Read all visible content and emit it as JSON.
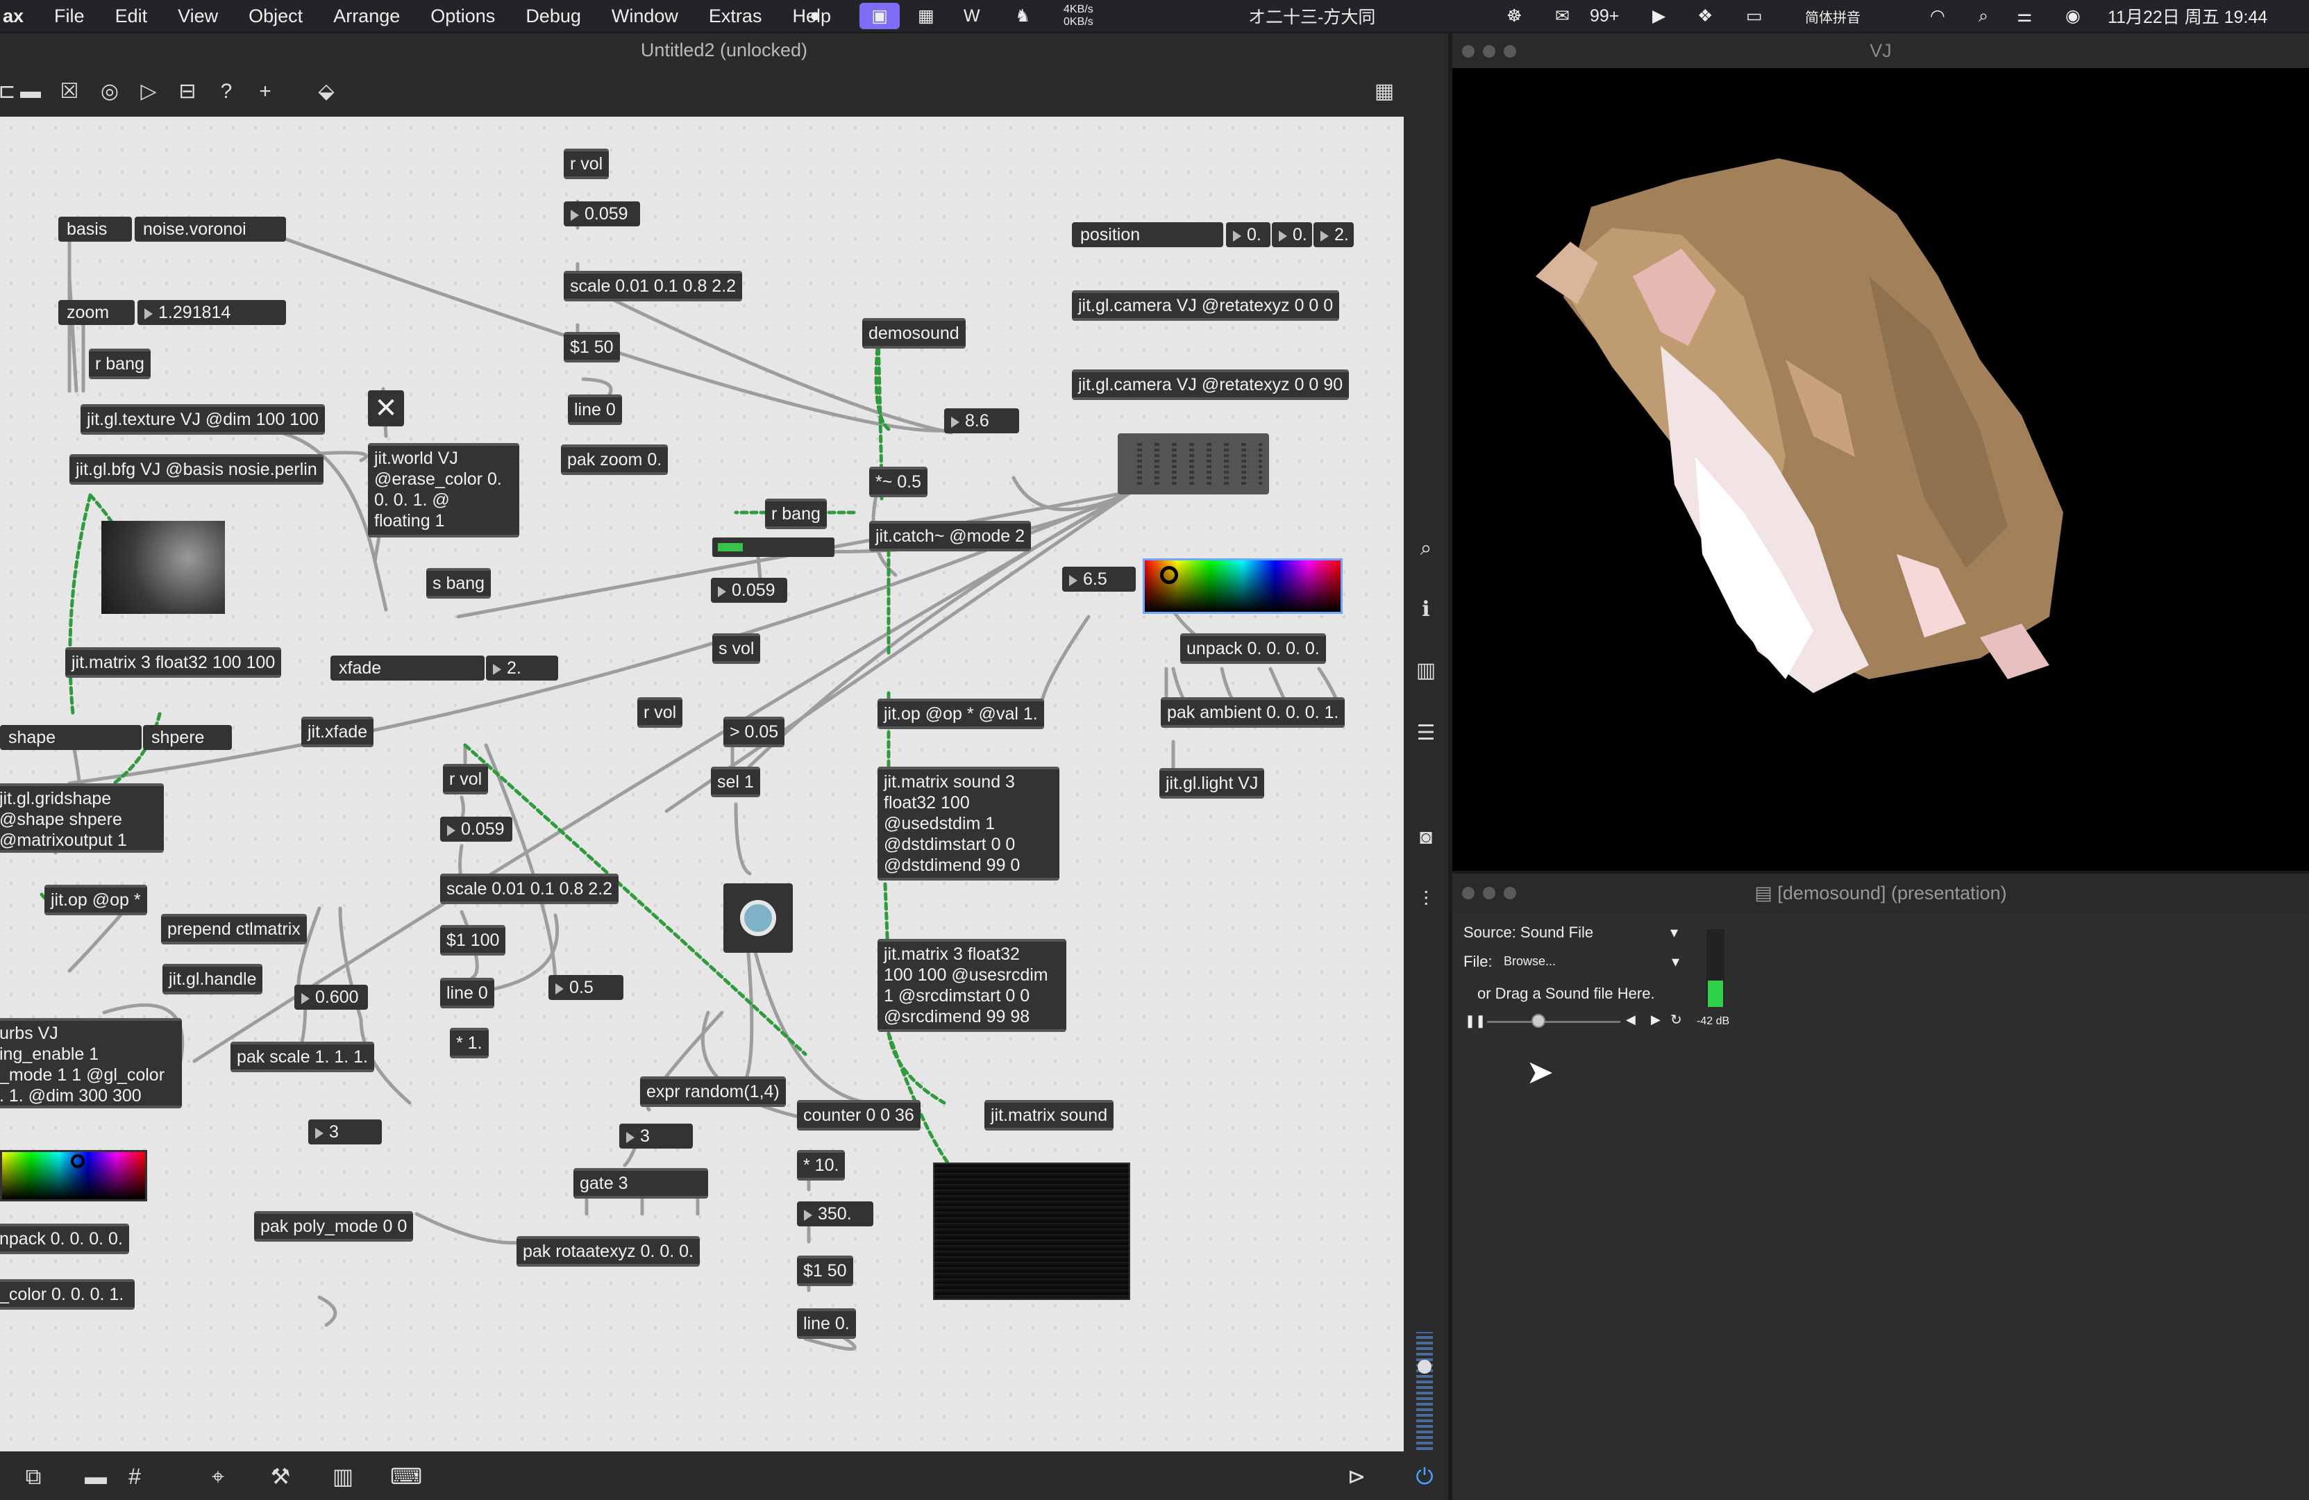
{
  "menubar": {
    "app": "ax",
    "items": [
      "File",
      "Edit",
      "View",
      "Object",
      "Arrange",
      "Options",
      "Debug",
      "Window",
      "Extras",
      "Help"
    ],
    "net_up": "4KB/s",
    "net_down": "0KB/s",
    "song": "オ二十三-方大同",
    "wechat_count": "99+",
    "input_method": "简体拼音",
    "datetime": "11月22日 周五  19:44"
  },
  "patcher": {
    "title": "Untitled2 (unlocked)",
    "objects": {
      "r_vol_top": "r vol",
      "num_0059_a": "0.059",
      "scale_a": "scale 0.01 0.1 0.8 2.2",
      "msg_150": "$1 50",
      "line0_a": "line 0",
      "pak_zoom": "pak zoom 0.",
      "basis_label": "basis",
      "basis_menu": "noise.voronoi",
      "zoom_label": "zoom",
      "zoom_num": "1.291814",
      "r_bang_a": "r bang",
      "texture": "jit.gl.texture VJ @dim 100 100",
      "bfg": "jit.gl.bfg VJ @basis nosie.perlin",
      "world": "jit.world VJ\n@erase_color 0.\n0. 0. 1. @\nfloating 1",
      "s_bang": "s bang",
      "matrix3": "jit.matrix 3 float32 100 100",
      "xfade_label": "xfade",
      "xfade_num": "2.",
      "jit_xfade": "jit.xfade",
      "shape_label": "shape",
      "shape_menu": "shpere",
      "gridshape": "jit.gl.gridshape\n@shape shpere\n@matrixoutput 1",
      "jitop": "jit.op @op *",
      "prepend": "prepend ctlmatrix",
      "handle": "jit.gl.handle",
      "nurbs": "urbs VJ\ning_enable 1\n_mode 1 1 @gl_color\n. 1. @dim 300 300",
      "num_0600": "0.600",
      "pak_scale": "pak scale 1. 1. 1.",
      "num_3_a": "3",
      "pak_poly": "pak poly_mode 0 0",
      "unpack_left": "npack 0. 0. 0. 0.",
      "color_left": "_color 0. 0. 0. 1.",
      "r_vol_b": "r vol",
      "num_0059_b": "0.059",
      "scale_b": "scale 0.01 0.1 0.8 2.2",
      "msg_1100": "$1 100",
      "line0_b": "line 0",
      "num_05": "0.5",
      "mul1": "* 1.",
      "demosound": "demosound",
      "r_bang_b": "r bang",
      "num_0059_c": "0.059",
      "s_vol": "s vol",
      "r_vol_c": "r vol",
      "gt005": "> 0.05",
      "sel1": "sel 1",
      "num_86": "8.6",
      "mul_tilde": "*~ 0.5",
      "catch": "jit.catch~ @mode 2",
      "num_65": "6.5",
      "jitop_val": "jit.op @op * @val 1.",
      "matrix_sound": "jit.matrix sound 3\nfloat32 100\n@usedstdim 1\n@dstdimstart 0 0\n@dstdimend 99 0",
      "matrix3b": "jit.matrix 3 float32\n100 100 @usesrcdim\n1 @srcdimstart 0 0\n@srcdimend 99 98",
      "expr": "expr random(1,4)",
      "num_3_b": "3",
      "gate3": "gate 3",
      "pak_rot": "pak rotaatexyz 0. 0. 0.",
      "counter": "counter 0 0 36",
      "mul10": "* 10.",
      "num_350": "350.",
      "msg_150b": "$1 50",
      "line0_c": "line 0.",
      "jit_matrix_sound": "jit.matrix sound",
      "position_label": "position",
      "pos_x": "0.",
      "pos_y": "0.",
      "pos_z": "2.",
      "camera_a": "jit.gl.camera VJ @retatexyz 0 0 0",
      "camera_b": "jit.gl.camera VJ @retatexyz 0 0 90",
      "unpack_right": "unpack 0. 0. 0. 0.",
      "pak_ambient": "pak ambient 0. 0. 0. 1.",
      "light": "jit.gl.light VJ"
    }
  },
  "vj": {
    "title": "VJ"
  },
  "demo": {
    "title": "[demosound] (presentation)",
    "source_label": "Source: Sound File",
    "file_label": "File:",
    "file_value": "Browse...",
    "drag_hint": "or Drag a Sound file Here.",
    "db": "-42 dB"
  },
  "colors": {
    "canvas": "#e6e6e6",
    "object": "#333333",
    "signal_wire": "#2f9a3e",
    "accent": "#7d6ef5"
  }
}
